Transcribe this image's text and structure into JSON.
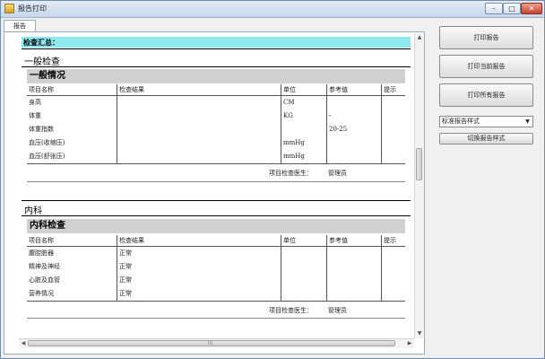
{
  "window": {
    "title": "报告打印",
    "controls": {
      "minimize": "–",
      "maximize": "□",
      "close": "✕"
    }
  },
  "tabs": [
    {
      "label": "报告"
    }
  ],
  "report": {
    "summary_label": "检查汇总：",
    "columns": [
      "项目名称",
      "检查结果",
      "单位",
      "参考值",
      "提示"
    ],
    "doctor_label": "项目检查医生：",
    "sections": [
      {
        "title": "一般检查",
        "subtitle": "一般情况",
        "rows": [
          {
            "name": "身高",
            "result": "",
            "unit": "CM",
            "ref": "",
            "hint": ""
          },
          {
            "name": "体重",
            "result": "",
            "unit": "KG",
            "ref": "-",
            "hint": ""
          },
          {
            "name": "体重指数",
            "result": "",
            "unit": "",
            "ref": "20-25",
            "hint": ""
          },
          {
            "name": "血压(收缩压)",
            "result": "",
            "unit": "mmHg",
            "ref": "",
            "hint": ""
          },
          {
            "name": "血压(舒张压)",
            "result": "",
            "unit": "mmHg",
            "ref": "",
            "hint": ""
          }
        ],
        "doctor": "管理员"
      },
      {
        "title": "内科",
        "subtitle": "内科检查",
        "rows": [
          {
            "name": "腹腔脏器",
            "result": "正常",
            "unit": "",
            "ref": "",
            "hint": ""
          },
          {
            "name": "精神及神经",
            "result": "正常",
            "unit": "",
            "ref": "",
            "hint": ""
          },
          {
            "name": "心脏及血管",
            "result": "正常",
            "unit": "",
            "ref": "",
            "hint": ""
          },
          {
            "name": "营养情况",
            "result": "正常",
            "unit": "",
            "ref": "",
            "hint": ""
          }
        ],
        "doctor": "管理员"
      }
    ]
  },
  "scrollbars": {
    "up": "▲",
    "down": "▼",
    "left": "◀",
    "right": "▶",
    "grip": "|||"
  },
  "actions": {
    "print_report": "打印报告",
    "print_current": "打印当前报告",
    "print_all": "打印所有报告",
    "style_select": "标准报告样式",
    "switch_style": "切换报告样式"
  },
  "colors": {
    "summary_bg": "#8fe8ef",
    "section_bg": "#d0d0d0"
  }
}
